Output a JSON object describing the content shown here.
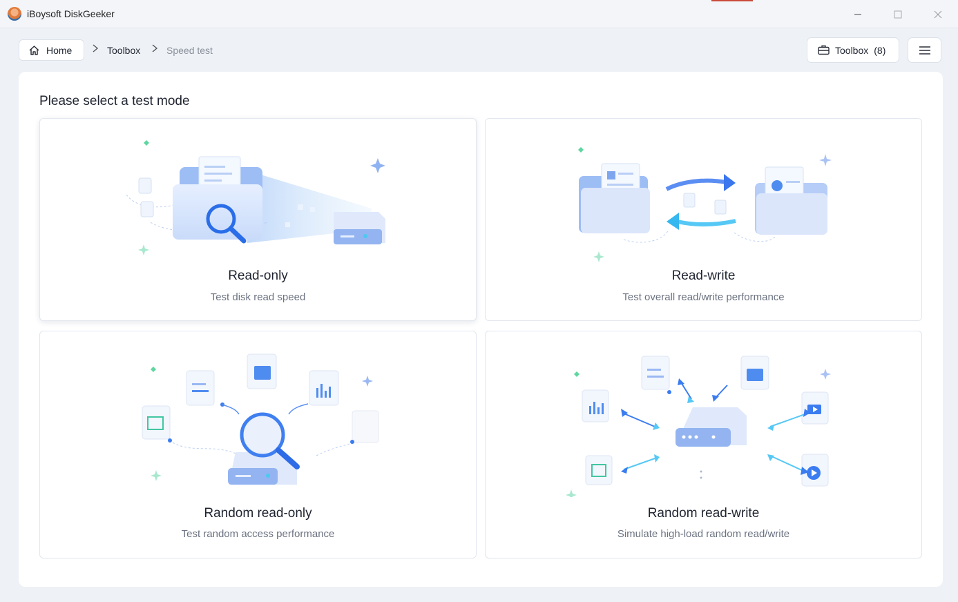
{
  "app": {
    "title": "iBoysoft DiskGeeker"
  },
  "window_controls": {
    "minimize": "—",
    "maximize": "☐",
    "close": "✕"
  },
  "breadcrumb": {
    "home_label": "Home",
    "toolbox_label": "Toolbox",
    "current_label": "Speed test"
  },
  "toolbar": {
    "toolbox_label": "Toolbox",
    "toolbox_count": "(8)"
  },
  "main": {
    "heading": "Please select a test mode",
    "modes": [
      {
        "title": "Read-only",
        "subtitle": "Test disk read speed"
      },
      {
        "title": "Read-write",
        "subtitle": "Test overall read/write performance"
      },
      {
        "title": "Random read-only",
        "subtitle": "Test random access performance"
      },
      {
        "title": "Random read-write",
        "subtitle": "Simulate high-load random read/write"
      }
    ]
  },
  "colors": {
    "accent_blue": "#3b7cf0",
    "light_blue": "#c9daf8",
    "cyan": "#56c8f5",
    "green_sparkle": "#5fd6a0"
  },
  "icons": [
    "home-icon",
    "chevron-right-icon",
    "toolbox-icon",
    "hamburger-menu-icon",
    "minimize-icon",
    "maximize-icon",
    "close-icon"
  ]
}
